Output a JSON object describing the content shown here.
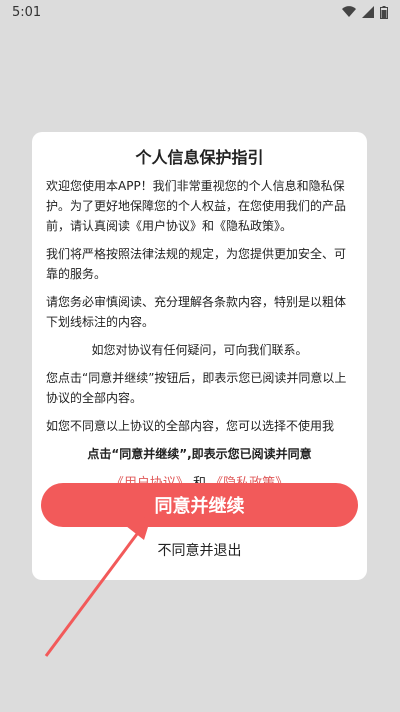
{
  "status": {
    "time": "5:01"
  },
  "dialog": {
    "title": "个人信息保护指引",
    "paragraphs": [
      "欢迎您使用本APP！我们非常重视您的个人信息和隐私保护。为了更好地保障您的个人权益，在您使用我们的产品前，请认真阅读《用户协议》和《隐私政策》。",
      "我们将严格按照法律法规的规定，为您提供更加安全、可靠的服务。",
      "请您务必审慎阅读、充分理解各条款内容，特别是以粗体下划线标注的内容。",
      "如您对协议有任何疑问，可向我们联系。",
      "您点击“同意并继续”按钮后，即表示您已阅读并同意以上协议的全部内容。",
      "如您不同意以上协议的全部内容，您可以选择不使用我"
    ],
    "bold_note": "点击“同意并继续”,即表示您已阅读并同意",
    "link_user": "《用户协议》",
    "link_and": "和",
    "link_privacy": "《隐私政策》",
    "agree_label": "同意并继续",
    "decline_label": "不同意并退出",
    "accent_color": "#f25a5a"
  }
}
